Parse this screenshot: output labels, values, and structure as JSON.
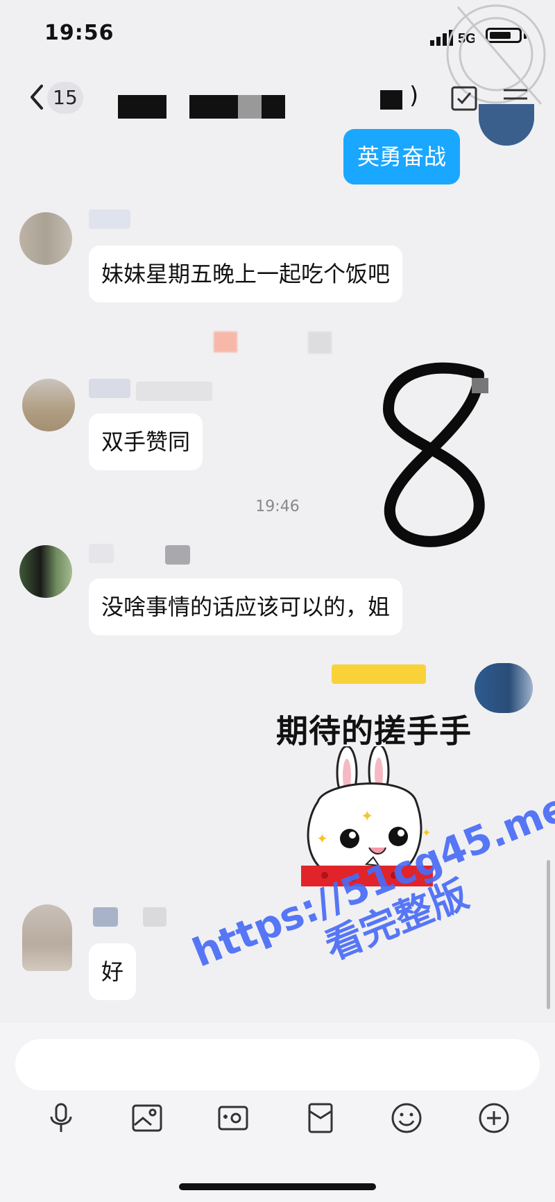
{
  "status_bar": {
    "time": "19:56",
    "signal_label": "5G"
  },
  "header": {
    "unread_count": "15",
    "title_tail": ")"
  },
  "messages": {
    "m1": "英勇奋战",
    "m2": "妹妹星期五晚上一起吃个饭吧",
    "m3": "双手赞同",
    "m4": "没啥事情的话应该可以的，姐",
    "m5": "好"
  },
  "timestamp": "19:46",
  "sticker": {
    "text": "期待的搓手手"
  },
  "watermark": {
    "url": "https://51cg45.me",
    "sub": "看完整版"
  },
  "overlay": {
    "handwritten": "8"
  },
  "icons": [
    "back-chevron-icon",
    "phone-icon",
    "menu-icon",
    "microphone-icon",
    "image-icon",
    "camera-icon",
    "red-envelope-icon",
    "emoji-icon",
    "plus-circle-icon"
  ]
}
